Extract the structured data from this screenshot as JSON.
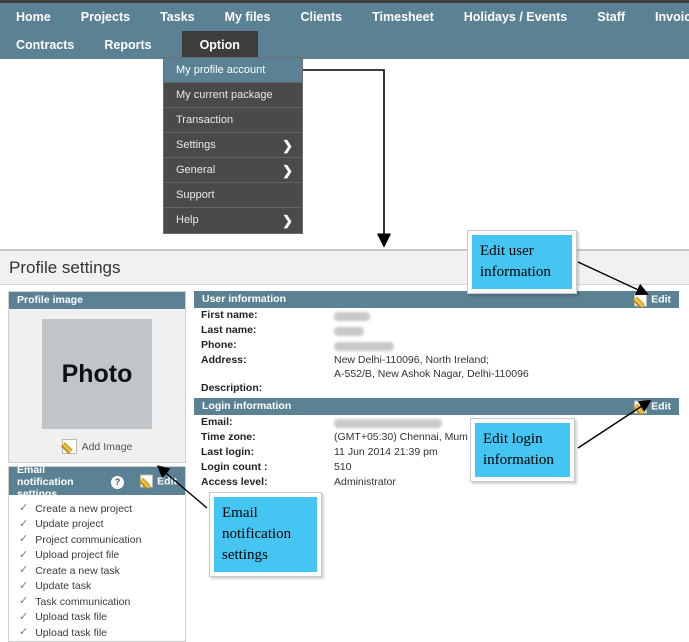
{
  "nav": {
    "row1": [
      "Home",
      "Projects",
      "Tasks",
      "My files",
      "Clients",
      "Timesheet",
      "Holidays / Events",
      "Staff",
      "Invoice"
    ],
    "row2": [
      "Contracts",
      "Reports"
    ],
    "active_tab": "Option"
  },
  "dropdown": {
    "items": [
      {
        "label": "My profile account",
        "arrow": "",
        "active": true
      },
      {
        "label": "My current package",
        "arrow": "",
        "active": false
      },
      {
        "label": "Transaction",
        "arrow": "",
        "active": false
      },
      {
        "label": "Settings",
        "arrow": "❯",
        "active": false
      },
      {
        "label": "General",
        "arrow": "❯",
        "active": false
      },
      {
        "label": "Support",
        "arrow": "",
        "active": false
      },
      {
        "label": "Help",
        "arrow": "❯",
        "active": false
      }
    ]
  },
  "page": {
    "title": "Profile settings"
  },
  "profile_image": {
    "header": "Profile image",
    "placeholder": "Photo",
    "add_image_label": "Add Image"
  },
  "email_notification": {
    "header_line1": "Email notification",
    "header_line2": "settings",
    "help_glyph": "?",
    "edit_label": "Edit",
    "items": [
      "Create a new project",
      "Update project",
      "Project communication",
      "Upload project file",
      "Create a new task",
      "Update task",
      "Task communication",
      "Upload task file",
      "Upload task file"
    ],
    "tick_glyph": "✓"
  },
  "user_information": {
    "header": "User information",
    "edit_label": "Edit",
    "rows": [
      {
        "label": "First name:",
        "value": "",
        "redacted": true,
        "redact_width": 36
      },
      {
        "label": "Last name:",
        "value": "",
        "redacted": true,
        "redact_width": 30
      },
      {
        "label": "Phone:",
        "value": "",
        "redacted": true,
        "redact_width": 60
      },
      {
        "label": "Address:",
        "value": "New Delhi-110096, North Ireland;\nA-552/B, New Ashok Nagar, Delhi-110096",
        "redacted": false
      },
      {
        "label": "Description:",
        "value": "",
        "redacted": false
      }
    ]
  },
  "login_information": {
    "header": "Login information",
    "edit_label": "Edit",
    "rows": [
      {
        "label": "Email:",
        "value": "",
        "redacted": true,
        "redact_width": 108
      },
      {
        "label": "Time zone:",
        "value": "(GMT+05:30) Chennai, Mum",
        "redacted": false
      },
      {
        "label": "Last login:",
        "value": "11 Jun 2014 21:39 pm",
        "redacted": false
      },
      {
        "label": "Login count :",
        "value": "510",
        "redacted": false
      },
      {
        "label": "Access level:",
        "value": "Administrator",
        "redacted": false
      }
    ]
  },
  "annotations": {
    "edit_user": "Edit user information",
    "edit_login": "Edit login information",
    "email_settings": "Email notification settings"
  },
  "colors": {
    "nav_teal": "#5b8294",
    "tab_dark": "#3d3d3d",
    "dropdown_bg": "#4a4a4a",
    "callout_cyan": "#45c6f2",
    "page_head": "#f1f1f1"
  }
}
